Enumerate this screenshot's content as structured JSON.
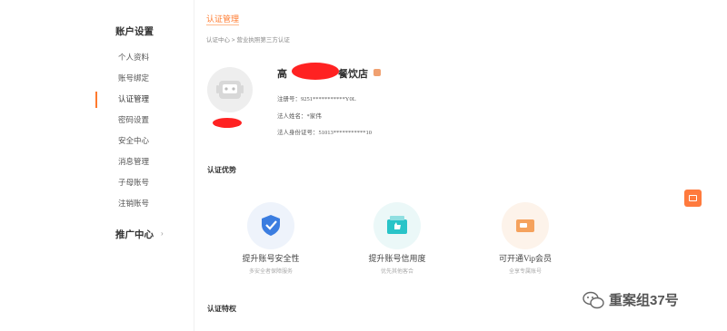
{
  "sidebar": {
    "title": "账户设置",
    "items": [
      {
        "label": "个人资料"
      },
      {
        "label": "账号绑定"
      },
      {
        "label": "认证管理",
        "active": true
      },
      {
        "label": "密码设置"
      },
      {
        "label": "安全中心"
      },
      {
        "label": "消息管理"
      },
      {
        "label": "子母账号"
      },
      {
        "label": "注销账号"
      }
    ],
    "promo_title": "推广中心",
    "promo_arrow": "›"
  },
  "header": {
    "tab": "认证管理",
    "breadcrumb": "认证中心 > 营业执照第三方认证"
  },
  "profile": {
    "company_prefix": "高",
    "company_suffix": "餐饮店",
    "reg_no": "注册号：9251***********Y0L",
    "legal_name": "法人姓名：*家伟",
    "legal_id": "法人身份证号：51013***********10"
  },
  "benefits": {
    "title": "认证优势",
    "items": [
      {
        "label": "提升账号安全性",
        "sub": "多安全者保障服务",
        "icon": "shield-check-icon",
        "color": "#3b7de0"
      },
      {
        "label": "提升账号信用度",
        "sub": "优先其他客合",
        "icon": "thumbs-up-icon",
        "color": "#29c4c8"
      },
      {
        "label": "可开通Vip会员",
        "sub": "全享专属账号",
        "icon": "vip-card-icon",
        "color": "#f5a25d"
      }
    ]
  },
  "privileges": {
    "title": "认证特权"
  },
  "watermark": {
    "text": "重案组37号"
  },
  "colors": {
    "accent": "#ff7a2e",
    "redaction": "#ff2222"
  }
}
